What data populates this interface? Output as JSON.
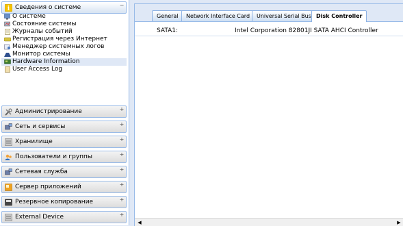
{
  "sidebar": {
    "system_info": {
      "title": "Сведения о системе",
      "items": [
        {
          "label": "О системе",
          "icon": "monitor-icon"
        },
        {
          "label": "Состояние системы",
          "icon": "status-icon"
        },
        {
          "label": "Журналы событий",
          "icon": "log-icon"
        },
        {
          "label": "Регистрация через Интернет",
          "icon": "register-icon"
        },
        {
          "label": "Менеджер системных логов",
          "icon": "log-manager-icon"
        },
        {
          "label": "Монитор системы",
          "icon": "system-monitor-icon"
        },
        {
          "label": "Hardware Information",
          "icon": "hardware-icon",
          "selected": true
        },
        {
          "label": "User Access Log",
          "icon": "user-log-icon"
        }
      ]
    },
    "sections": [
      {
        "label": "Администрирование",
        "icon": "tools-icon"
      },
      {
        "label": "Сеть и сервисы",
        "icon": "network-icon"
      },
      {
        "label": "Хранилище",
        "icon": "storage-icon"
      },
      {
        "label": "Пользователи и группы",
        "icon": "users-icon"
      },
      {
        "label": "Сетевая служба",
        "icon": "network-service-icon"
      },
      {
        "label": "Сервер приложений",
        "icon": "app-server-icon"
      },
      {
        "label": "Резервное копирование",
        "icon": "backup-icon"
      },
      {
        "label": "External Device",
        "icon": "external-device-icon"
      }
    ]
  },
  "tabs": [
    {
      "label": "General"
    },
    {
      "label": "Network Interface Card"
    },
    {
      "label": "Universal Serial Bus"
    },
    {
      "label": "Disk Controller",
      "active": true
    }
  ],
  "disk_controller": {
    "rows": [
      {
        "key": "SATA1:",
        "value": "Intel Corporation 82801JI SATA AHCI Controller"
      }
    ]
  },
  "colors": {
    "accent": "#99bbe8",
    "selected": "#dfe8f6"
  }
}
